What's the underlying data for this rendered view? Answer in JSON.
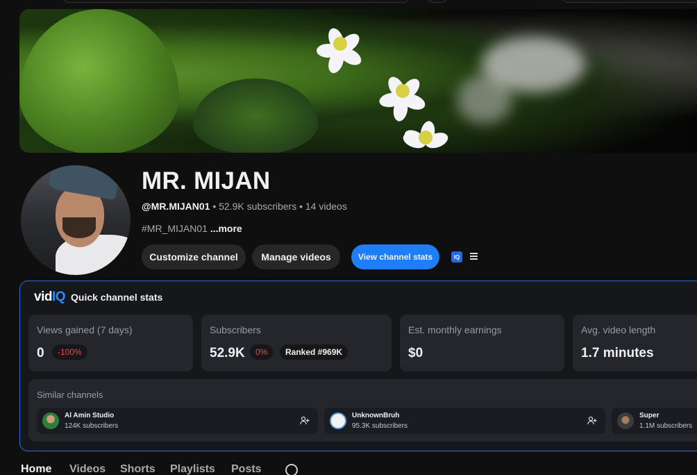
{
  "channel": {
    "name": "MR. MIJAN",
    "handle": "@MR.MIJAN01",
    "subscribers": "52.9K subscribers",
    "videos": "14 videos",
    "separator": "•",
    "description": "#MR_MIJAN01",
    "more_label": "...more"
  },
  "actions": {
    "customize": "Customize channel",
    "manage": "Manage videos",
    "stats": "View channel stats",
    "iq_badge": "IQ"
  },
  "vidiq": {
    "logo_main": "vid",
    "logo_accent": "IQ",
    "title": "Quick channel stats",
    "cards": [
      {
        "label": "Views gained (7 days)",
        "value": "0",
        "pill": "-100%"
      },
      {
        "label": "Subscribers",
        "value": "52.9K",
        "pill": "0%",
        "rank": "Ranked #969K"
      },
      {
        "label": "Est. monthly earnings",
        "value": "$0"
      },
      {
        "label": "Avg. video length",
        "value": "1.7 minutes"
      }
    ],
    "similar": {
      "label": "Similar channels",
      "items": [
        {
          "name": "Al Amin Studio",
          "subs": "124K subscribers"
        },
        {
          "name": "UnknownBruh",
          "subs": "95.3K subscribers"
        },
        {
          "name": "Super",
          "subs": "1.1M subscribers"
        }
      ]
    }
  },
  "tabs": [
    "Home",
    "Videos",
    "Shorts",
    "Playlists",
    "Posts"
  ],
  "colors": {
    "accent": "#1f7df6",
    "panel_border": "#2b6fd6",
    "negative": "#e84a52"
  }
}
